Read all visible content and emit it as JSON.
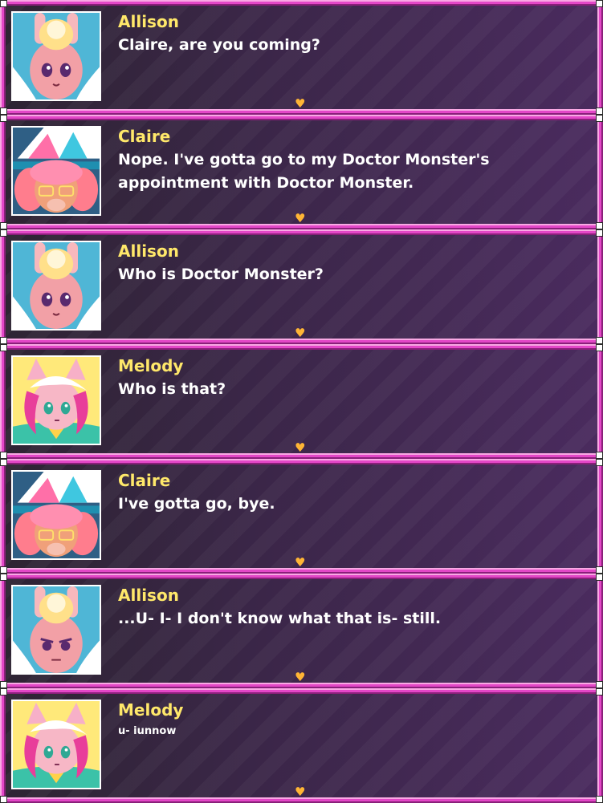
{
  "colors": {
    "name": "#ffe86a",
    "text": "#ffffff",
    "frame": "#e347c7",
    "heart": "#ffb535"
  },
  "advance_icon": "heart-icon",
  "dialogue": [
    {
      "speaker": "Allison",
      "text": "Claire, are you coming?",
      "portrait": "allison-neutral"
    },
    {
      "speaker": "Claire",
      "text": "Nope. I've gotta go to my Doctor Monster's appointment with Doctor Monster.",
      "portrait": "claire"
    },
    {
      "speaker": "Allison",
      "text": "Who is Doctor Monster?",
      "portrait": "allison-neutral"
    },
    {
      "speaker": "Melody",
      "text": "Who is that?",
      "portrait": "melody"
    },
    {
      "speaker": "Claire",
      "text": "I've gotta go, bye.",
      "portrait": "claire"
    },
    {
      "speaker": "Allison",
      "text": "...U- I- I don't know what that is- still.",
      "portrait": "allison-frown"
    },
    {
      "speaker": "Melody",
      "text": "u- iunnow",
      "portrait": "melody"
    }
  ]
}
